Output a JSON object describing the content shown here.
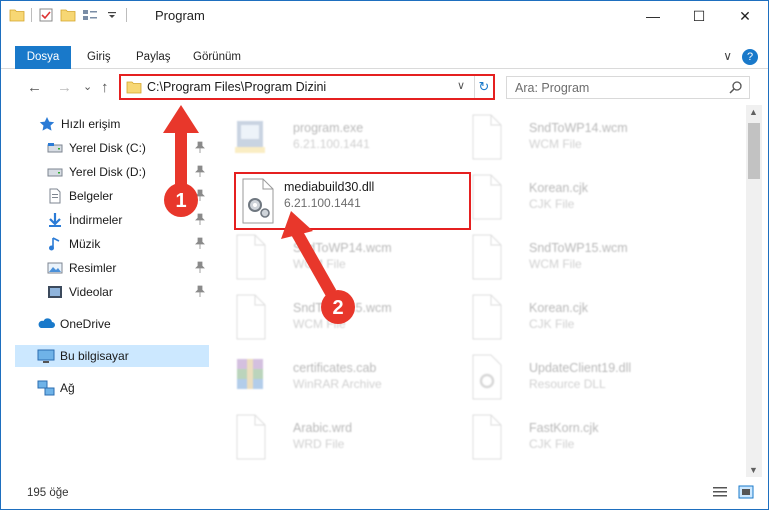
{
  "window": {
    "title": "Program",
    "controls": {
      "minimize": "—",
      "maximize": "☐",
      "close": "✕"
    }
  },
  "ribbon": {
    "tabs": [
      "Dosya",
      "Giriş",
      "Paylaş",
      "Görünüm"
    ],
    "expand_glyph": "∨",
    "help_glyph": "?"
  },
  "navigation": {
    "back": "←",
    "forward": "→",
    "recent": "⌄",
    "up": "↑",
    "address_path": "C:\\Program Files\\Program Dizini",
    "address_dropdown": "∨",
    "refresh_glyph": "↻",
    "search_placeholder": "Ara: Program"
  },
  "sidebar": {
    "items": [
      {
        "label": "Hızlı erişim",
        "icon": "star-icon",
        "pinned": false
      },
      {
        "label": "Yerel Disk (C:)",
        "icon": "drive-c-icon",
        "pinned": true
      },
      {
        "label": "Yerel Disk (D:)",
        "icon": "drive-d-icon",
        "pinned": true
      },
      {
        "label": "Belgeler",
        "icon": "documents-icon",
        "pinned": true
      },
      {
        "label": "İndirmeler",
        "icon": "downloads-icon",
        "pinned": true
      },
      {
        "label": "Müzik",
        "icon": "music-icon",
        "pinned": true
      },
      {
        "label": "Resimler",
        "icon": "pictures-icon",
        "pinned": true
      },
      {
        "label": "Videolar",
        "icon": "videos-icon",
        "pinned": true
      },
      {
        "label": "OneDrive",
        "icon": "onedrive-icon",
        "pinned": false
      },
      {
        "label": "Bu bilgisayar",
        "icon": "this-pc-icon",
        "pinned": false
      },
      {
        "label": "Ağ",
        "icon": "network-icon",
        "pinned": false
      }
    ]
  },
  "files": {
    "left": [
      {
        "name": "program.exe",
        "desc": "6.21.100.1441",
        "icon": "exe-icon"
      },
      {
        "name": "mediabuild30.dll",
        "desc": "6.21.100.1441",
        "icon": "dll-gear-icon",
        "highlighted": true
      },
      {
        "name": "SndToWP14.wcm",
        "desc": "WCM File",
        "icon": "blank-file-icon"
      },
      {
        "name": "SndToWP15.wcm",
        "desc": "WCM File",
        "icon": "blank-file-icon"
      },
      {
        "name": "certificates.cab",
        "desc": "WinRAR Archive",
        "icon": "winrar-icon"
      },
      {
        "name": "Arabic.wrd",
        "desc": "WRD File",
        "icon": "blank-file-icon"
      }
    ],
    "right": [
      {
        "name": "SndToWP14.wcm",
        "desc": "WCM File",
        "icon": "blank-file-icon"
      },
      {
        "name": "Korean.cjk",
        "desc": "CJK File",
        "icon": "blank-file-icon"
      },
      {
        "name": "SndToWP15.wcm",
        "desc": "WCM File",
        "icon": "blank-file-icon"
      },
      {
        "name": "Korean.cjk",
        "desc": "CJK File",
        "icon": "blank-file-icon"
      },
      {
        "name": "UpdateClient19.dll",
        "desc": "Resource DLL",
        "icon": "dll-icon"
      },
      {
        "name": "FastKorn.cjk",
        "desc": "CJK File",
        "icon": "blank-file-icon"
      }
    ]
  },
  "status": {
    "item_count": "195 öğe"
  },
  "annotations": {
    "step1": "1",
    "step2": "2",
    "color": "#e8372b"
  },
  "colors": {
    "accent": "#1979ca",
    "highlight_border": "#e52020",
    "selected_bg": "#cce8ff"
  }
}
